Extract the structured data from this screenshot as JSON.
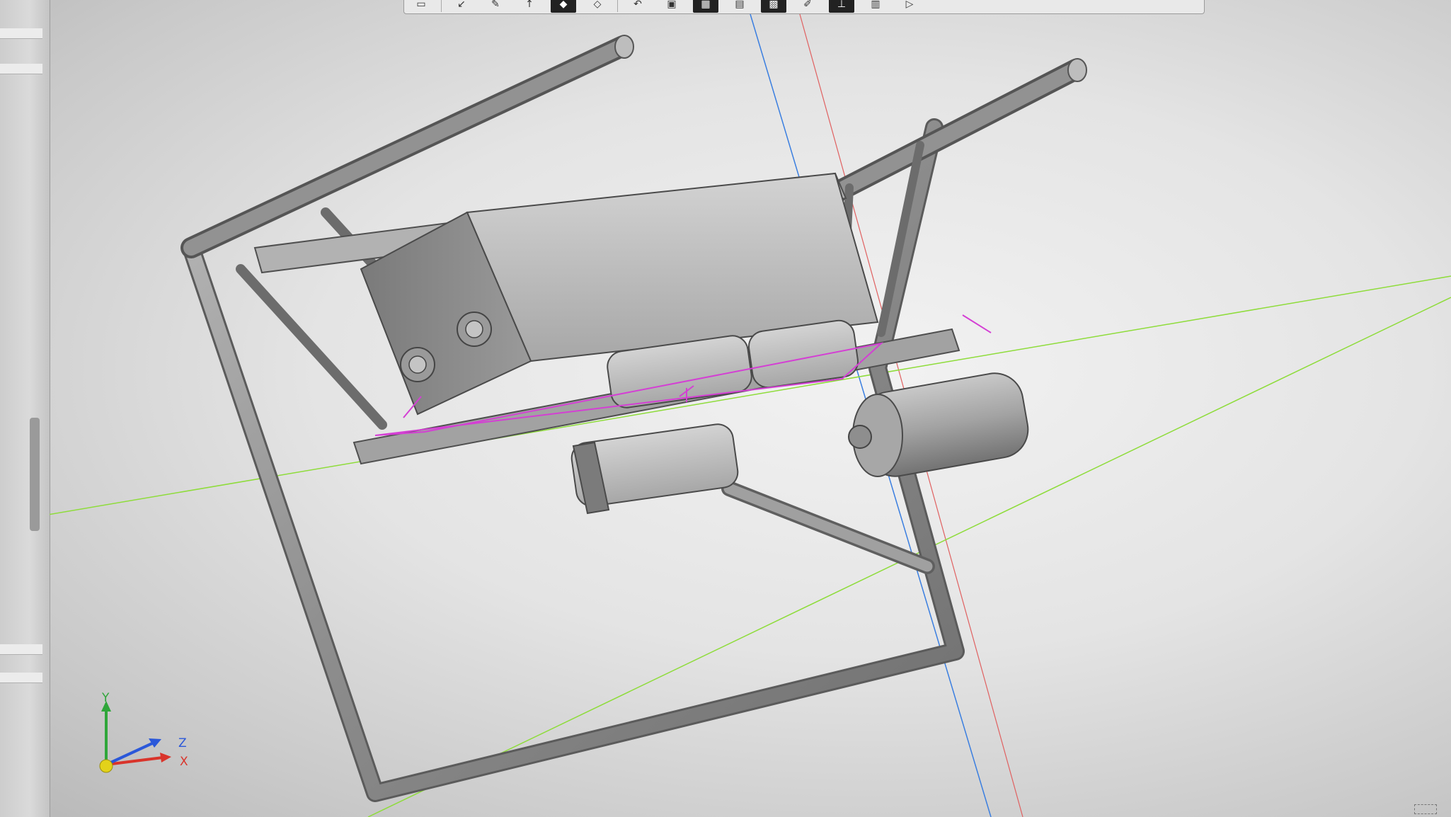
{
  "toolbar": {
    "buttons": [
      {
        "icon": "frame-icon"
      },
      {
        "icon": "arrow-icon"
      },
      {
        "icon": "pencil-icon"
      },
      {
        "icon": "pointer-icon"
      },
      {
        "icon": "solid-view-icon",
        "active": true
      },
      {
        "icon": "wireframe-view-icon"
      },
      {
        "icon": "undo-icon"
      },
      {
        "icon": "screen-icon"
      },
      {
        "icon": "mesh-icon",
        "active": true
      },
      {
        "icon": "layers-icon"
      },
      {
        "icon": "render-icon",
        "active": true
      },
      {
        "icon": "edit-icon"
      },
      {
        "icon": "pin-icon",
        "active": true
      },
      {
        "icon": "chart-icon"
      },
      {
        "icon": "play-icon"
      }
    ]
  },
  "triad": {
    "x_label": "X",
    "y_label": "Y",
    "z_label": "Z",
    "colors": {
      "x": "#d9342b",
      "y": "#2fa63a",
      "z": "#2b58d9",
      "origin": "#e3d21a"
    }
  },
  "scene": {
    "model_color": "#8e8e8e",
    "sketch_color": "#d43fd4",
    "axis_colors": {
      "red": "#e06060",
      "green": "#8edc3a",
      "blue": "#3a7ee0"
    }
  }
}
